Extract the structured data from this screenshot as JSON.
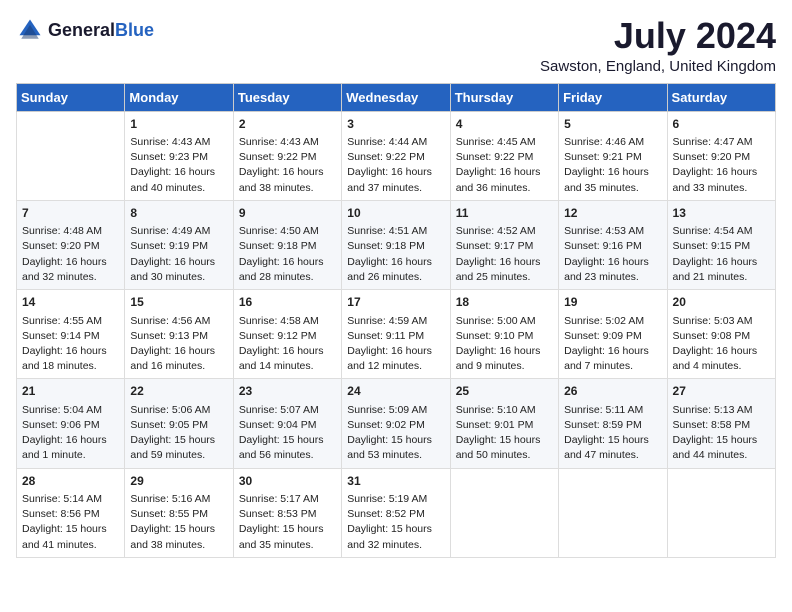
{
  "logo": {
    "text_general": "General",
    "text_blue": "Blue"
  },
  "header": {
    "month": "July 2024",
    "location": "Sawston, England, United Kingdom"
  },
  "weekdays": [
    "Sunday",
    "Monday",
    "Tuesday",
    "Wednesday",
    "Thursday",
    "Friday",
    "Saturday"
  ],
  "weeks": [
    [
      {
        "day": "",
        "content": ""
      },
      {
        "day": "1",
        "content": "Sunrise: 4:43 AM\nSunset: 9:23 PM\nDaylight: 16 hours\nand 40 minutes."
      },
      {
        "day": "2",
        "content": "Sunrise: 4:43 AM\nSunset: 9:22 PM\nDaylight: 16 hours\nand 38 minutes."
      },
      {
        "day": "3",
        "content": "Sunrise: 4:44 AM\nSunset: 9:22 PM\nDaylight: 16 hours\nand 37 minutes."
      },
      {
        "day": "4",
        "content": "Sunrise: 4:45 AM\nSunset: 9:22 PM\nDaylight: 16 hours\nand 36 minutes."
      },
      {
        "day": "5",
        "content": "Sunrise: 4:46 AM\nSunset: 9:21 PM\nDaylight: 16 hours\nand 35 minutes."
      },
      {
        "day": "6",
        "content": "Sunrise: 4:47 AM\nSunset: 9:20 PM\nDaylight: 16 hours\nand 33 minutes."
      }
    ],
    [
      {
        "day": "7",
        "content": "Sunrise: 4:48 AM\nSunset: 9:20 PM\nDaylight: 16 hours\nand 32 minutes."
      },
      {
        "day": "8",
        "content": "Sunrise: 4:49 AM\nSunset: 9:19 PM\nDaylight: 16 hours\nand 30 minutes."
      },
      {
        "day": "9",
        "content": "Sunrise: 4:50 AM\nSunset: 9:18 PM\nDaylight: 16 hours\nand 28 minutes."
      },
      {
        "day": "10",
        "content": "Sunrise: 4:51 AM\nSunset: 9:18 PM\nDaylight: 16 hours\nand 26 minutes."
      },
      {
        "day": "11",
        "content": "Sunrise: 4:52 AM\nSunset: 9:17 PM\nDaylight: 16 hours\nand 25 minutes."
      },
      {
        "day": "12",
        "content": "Sunrise: 4:53 AM\nSunset: 9:16 PM\nDaylight: 16 hours\nand 23 minutes."
      },
      {
        "day": "13",
        "content": "Sunrise: 4:54 AM\nSunset: 9:15 PM\nDaylight: 16 hours\nand 21 minutes."
      }
    ],
    [
      {
        "day": "14",
        "content": "Sunrise: 4:55 AM\nSunset: 9:14 PM\nDaylight: 16 hours\nand 18 minutes."
      },
      {
        "day": "15",
        "content": "Sunrise: 4:56 AM\nSunset: 9:13 PM\nDaylight: 16 hours\nand 16 minutes."
      },
      {
        "day": "16",
        "content": "Sunrise: 4:58 AM\nSunset: 9:12 PM\nDaylight: 16 hours\nand 14 minutes."
      },
      {
        "day": "17",
        "content": "Sunrise: 4:59 AM\nSunset: 9:11 PM\nDaylight: 16 hours\nand 12 minutes."
      },
      {
        "day": "18",
        "content": "Sunrise: 5:00 AM\nSunset: 9:10 PM\nDaylight: 16 hours\nand 9 minutes."
      },
      {
        "day": "19",
        "content": "Sunrise: 5:02 AM\nSunset: 9:09 PM\nDaylight: 16 hours\nand 7 minutes."
      },
      {
        "day": "20",
        "content": "Sunrise: 5:03 AM\nSunset: 9:08 PM\nDaylight: 16 hours\nand 4 minutes."
      }
    ],
    [
      {
        "day": "21",
        "content": "Sunrise: 5:04 AM\nSunset: 9:06 PM\nDaylight: 16 hours\nand 1 minute."
      },
      {
        "day": "22",
        "content": "Sunrise: 5:06 AM\nSunset: 9:05 PM\nDaylight: 15 hours\nand 59 minutes."
      },
      {
        "day": "23",
        "content": "Sunrise: 5:07 AM\nSunset: 9:04 PM\nDaylight: 15 hours\nand 56 minutes."
      },
      {
        "day": "24",
        "content": "Sunrise: 5:09 AM\nSunset: 9:02 PM\nDaylight: 15 hours\nand 53 minutes."
      },
      {
        "day": "25",
        "content": "Sunrise: 5:10 AM\nSunset: 9:01 PM\nDaylight: 15 hours\nand 50 minutes."
      },
      {
        "day": "26",
        "content": "Sunrise: 5:11 AM\nSunset: 8:59 PM\nDaylight: 15 hours\nand 47 minutes."
      },
      {
        "day": "27",
        "content": "Sunrise: 5:13 AM\nSunset: 8:58 PM\nDaylight: 15 hours\nand 44 minutes."
      }
    ],
    [
      {
        "day": "28",
        "content": "Sunrise: 5:14 AM\nSunset: 8:56 PM\nDaylight: 15 hours\nand 41 minutes."
      },
      {
        "day": "29",
        "content": "Sunrise: 5:16 AM\nSunset: 8:55 PM\nDaylight: 15 hours\nand 38 minutes."
      },
      {
        "day": "30",
        "content": "Sunrise: 5:17 AM\nSunset: 8:53 PM\nDaylight: 15 hours\nand 35 minutes."
      },
      {
        "day": "31",
        "content": "Sunrise: 5:19 AM\nSunset: 8:52 PM\nDaylight: 15 hours\nand 32 minutes."
      },
      {
        "day": "",
        "content": ""
      },
      {
        "day": "",
        "content": ""
      },
      {
        "day": "",
        "content": ""
      }
    ]
  ]
}
